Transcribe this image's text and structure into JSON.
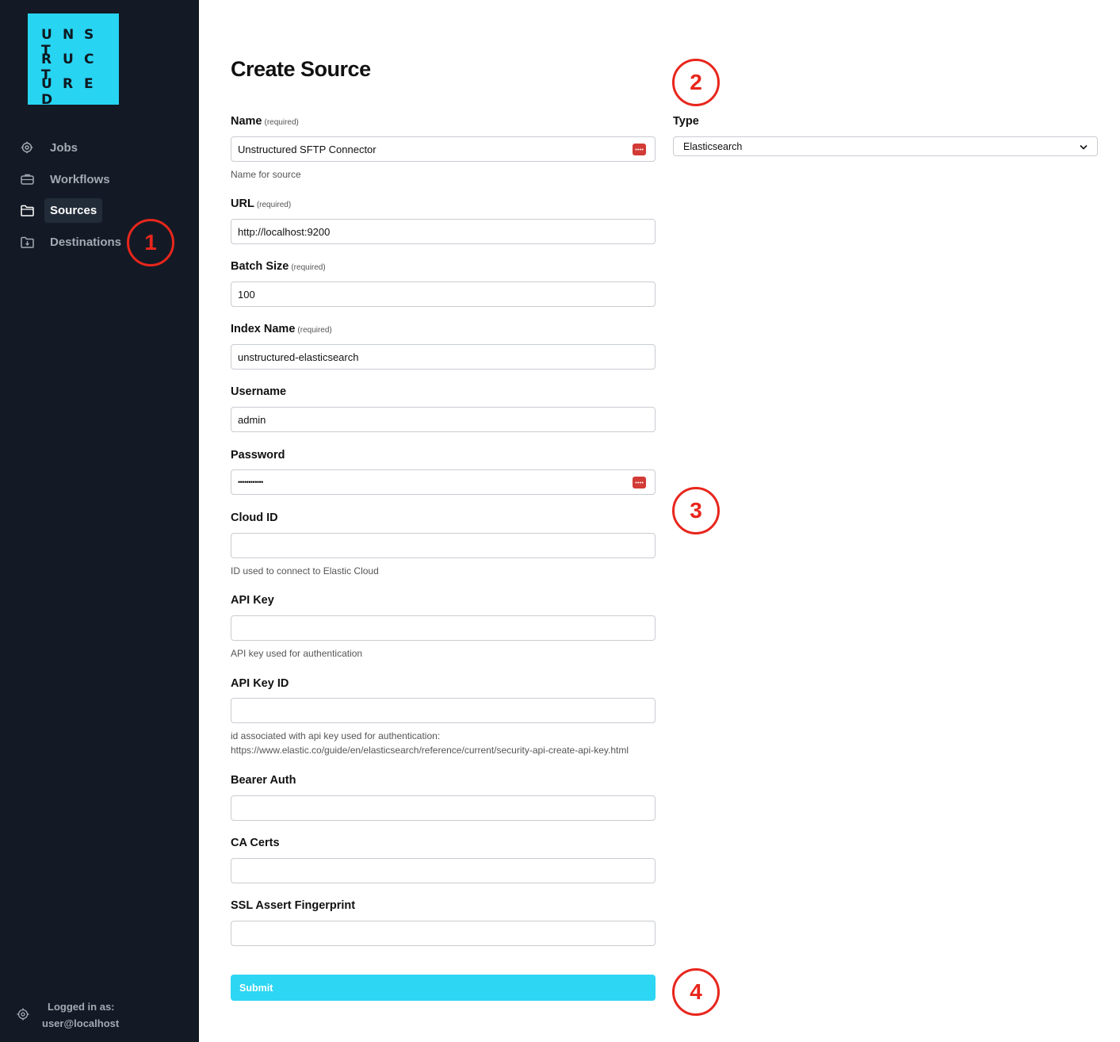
{
  "logo": {
    "rows": [
      [
        "U",
        "N",
        "S",
        "T"
      ],
      [
        "R",
        "U",
        "C",
        "T"
      ],
      [
        "U",
        "R",
        "E",
        "D"
      ]
    ]
  },
  "sidebar": {
    "items": [
      {
        "label": "Jobs",
        "icon": "gear-icon"
      },
      {
        "label": "Workflows",
        "icon": "briefcase-icon"
      },
      {
        "label": "Sources",
        "icon": "folder-icon"
      },
      {
        "label": "Destinations",
        "icon": "folder-download-icon"
      }
    ],
    "active": "Sources",
    "footer": {
      "logged_in_label": "Logged in as:",
      "user": "user@localhost"
    }
  },
  "page": {
    "title": "Create Source"
  },
  "form": {
    "required_tag": "(required)",
    "fields": [
      {
        "label": "Name",
        "required": true,
        "value": "Unstructured SFTP Connector",
        "help": "Name for source"
      },
      {
        "label": "URL",
        "required": true,
        "value": "http://localhost:9200",
        "help": ""
      },
      {
        "label": "Batch Size",
        "required": true,
        "value": "100",
        "help": ""
      },
      {
        "label": "Index Name",
        "required": true,
        "value": "unstructured-elasticsearch",
        "help": ""
      },
      {
        "label": "Username",
        "required": false,
        "value": "admin",
        "help": ""
      },
      {
        "label": "Password",
        "required": false,
        "value": "••••••••••••",
        "help": ""
      },
      {
        "label": "Cloud ID",
        "required": false,
        "value": "",
        "help": "ID used to connect to Elastic Cloud"
      },
      {
        "label": "API Key",
        "required": false,
        "value": "",
        "help": "API key used for authentication"
      },
      {
        "label": "API Key ID",
        "required": false,
        "value": "",
        "help_line1": "id associated with api key used for authentication:",
        "help_line2": "https://www.elastic.co/guide/en/elasticsearch/reference/current/security-api-create-api-key.html"
      },
      {
        "label": "Bearer Auth",
        "required": false,
        "value": "",
        "help": ""
      },
      {
        "label": "CA Certs",
        "required": false,
        "value": "",
        "help": ""
      },
      {
        "label": "SSL Assert Fingerprint",
        "required": false,
        "value": "",
        "help": ""
      }
    ],
    "type": {
      "label": "Type",
      "value": "Elasticsearch"
    },
    "submit_label": "Submit"
  },
  "annotations": [
    "1",
    "2",
    "3",
    "4"
  ],
  "colors": {
    "sidebar": "#131a25",
    "accent": "#27d4f2",
    "annotation": "#e8261c",
    "password_icon": "#d23b36"
  }
}
